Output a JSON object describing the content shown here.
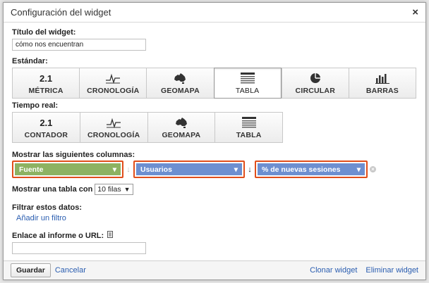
{
  "dialog": {
    "title": "Configuración del widget",
    "close_label": "×"
  },
  "widget_title": {
    "label": "Título del widget:",
    "value": "cómo nos encuentran"
  },
  "standard": {
    "label": "Estándar:",
    "options": [
      {
        "icon_text": "2.1",
        "label": "MÉTRICA"
      },
      {
        "icon_text": "",
        "label": "CRONOLOGÍA"
      },
      {
        "icon_text": "",
        "label": "GEOMAPA"
      },
      {
        "icon_text": "",
        "label": "TABLA"
      },
      {
        "icon_text": "",
        "label": "CIRCULAR"
      },
      {
        "icon_text": "",
        "label": "BARRAS"
      }
    ],
    "selected": "TABLA"
  },
  "realtime": {
    "label": "Tiempo real:",
    "options": [
      {
        "icon_text": "2.1",
        "label": "CONTADOR"
      },
      {
        "icon_text": "",
        "label": "CRONOLOGÍA"
      },
      {
        "icon_text": "",
        "label": "GEOMAPA"
      },
      {
        "icon_text": "",
        "label": "TABLA"
      }
    ]
  },
  "columns": {
    "label": "Mostrar las siguientes columnas:",
    "items": [
      {
        "value": "Fuente",
        "color": "#8db262"
      },
      {
        "value": "Usuarios",
        "color": "#6d8fd0"
      },
      {
        "value": "% de nuevas sesiones",
        "color": "#6d8fd0"
      }
    ],
    "highlight_color": "#e04e1b"
  },
  "table_rows": {
    "label": "Mostrar una tabla con",
    "value": "10 filas"
  },
  "filter": {
    "label": "Filtrar estos datos:",
    "add_link": "Añadir un filtro"
  },
  "report_link": {
    "label": "Enlace al informe o URL:",
    "value": ""
  },
  "footer": {
    "save": "Guardar",
    "cancel": "Cancelar",
    "clone": "Clonar widget",
    "delete": "Eliminar widget"
  }
}
